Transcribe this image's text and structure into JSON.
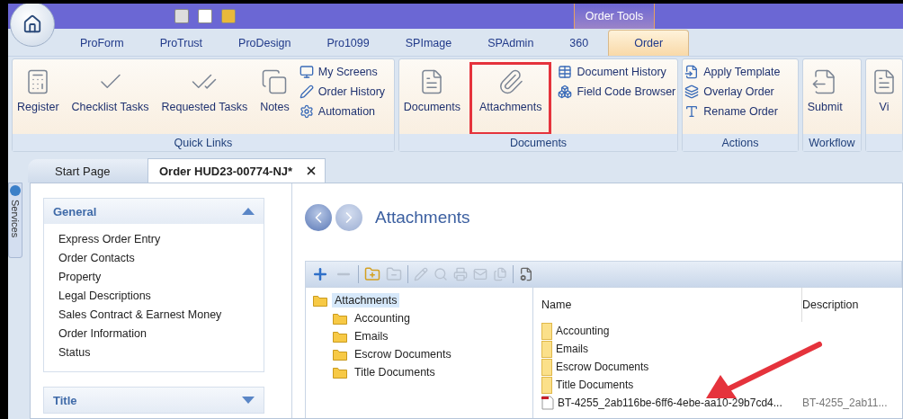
{
  "app_tabs": [
    {
      "label": "ProForm",
      "selected": false
    },
    {
      "label": "ProTrust",
      "selected": false
    },
    {
      "label": "ProDesign",
      "selected": false
    },
    {
      "label": "Pro1099",
      "selected": false
    },
    {
      "label": "SPImage",
      "selected": false
    },
    {
      "label": "SPAdmin",
      "selected": false
    },
    {
      "label": "360",
      "selected": false
    },
    {
      "label": "Order",
      "selected": true
    }
  ],
  "contextual_header": "Order Tools",
  "ribbon": {
    "groups": [
      {
        "label": "Quick Links",
        "large": [
          {
            "label": "Register",
            "highlighted": false
          },
          {
            "label": "Checklist Tasks",
            "highlighted": false
          },
          {
            "label": "Requested Tasks",
            "highlighted": false
          },
          {
            "label": "Notes",
            "highlighted": false
          }
        ],
        "small": [
          "My Screens",
          "Order History",
          "Automation"
        ]
      },
      {
        "label": "Documents",
        "large": [
          {
            "label": "Documents",
            "highlighted": false
          },
          {
            "label": "Attachments",
            "highlighted": true
          }
        ],
        "small": [
          "Document History",
          "Field Code Browser"
        ]
      },
      {
        "label": "Actions",
        "small": [
          "Apply Template",
          "Overlay Order",
          "Rename Order"
        ]
      },
      {
        "label": "Workflow",
        "large": [
          {
            "label": "Submit",
            "highlighted": false
          }
        ]
      },
      {
        "large": [
          {
            "label": "Vi",
            "highlighted": false
          }
        ]
      }
    ]
  },
  "side_tab": "Services",
  "doc_tabs": [
    {
      "label": "Start Page",
      "selected": false,
      "closable": false
    },
    {
      "label": "Order HUD23-00774-NJ*",
      "selected": true,
      "closable": true
    }
  ],
  "nav_panels": [
    {
      "title": "General",
      "expanded": true,
      "items": [
        "Express Order Entry",
        "Order Contacts",
        "Property",
        "Legal Descriptions",
        "Sales Contract & Earnest Money",
        "Order Information",
        "Status"
      ]
    },
    {
      "title": "Title",
      "expanded": false
    }
  ],
  "page_title": "Attachments",
  "tree": [
    {
      "label": "Attachments",
      "selected": true,
      "children": [
        {
          "label": "Accounting",
          "selected": false
        },
        {
          "label": "Emails",
          "selected": false
        },
        {
          "label": "Escrow Documents",
          "selected": false
        },
        {
          "label": "Title Documents",
          "selected": false
        }
      ]
    }
  ],
  "file_list": {
    "columns": [
      "Name",
      "Description"
    ],
    "rows": [
      {
        "kind": "folder",
        "name": "Accounting"
      },
      {
        "kind": "folder",
        "name": "Emails"
      },
      {
        "kind": "folder",
        "name": "Escrow Documents"
      },
      {
        "kind": "folder",
        "name": "Title Documents"
      },
      {
        "kind": "file",
        "name": "BT-4255_2ab116be-6ff6-4ebe-aa10-29b7cd4...",
        "description": "BT-4255_2ab11..."
      }
    ]
  }
}
